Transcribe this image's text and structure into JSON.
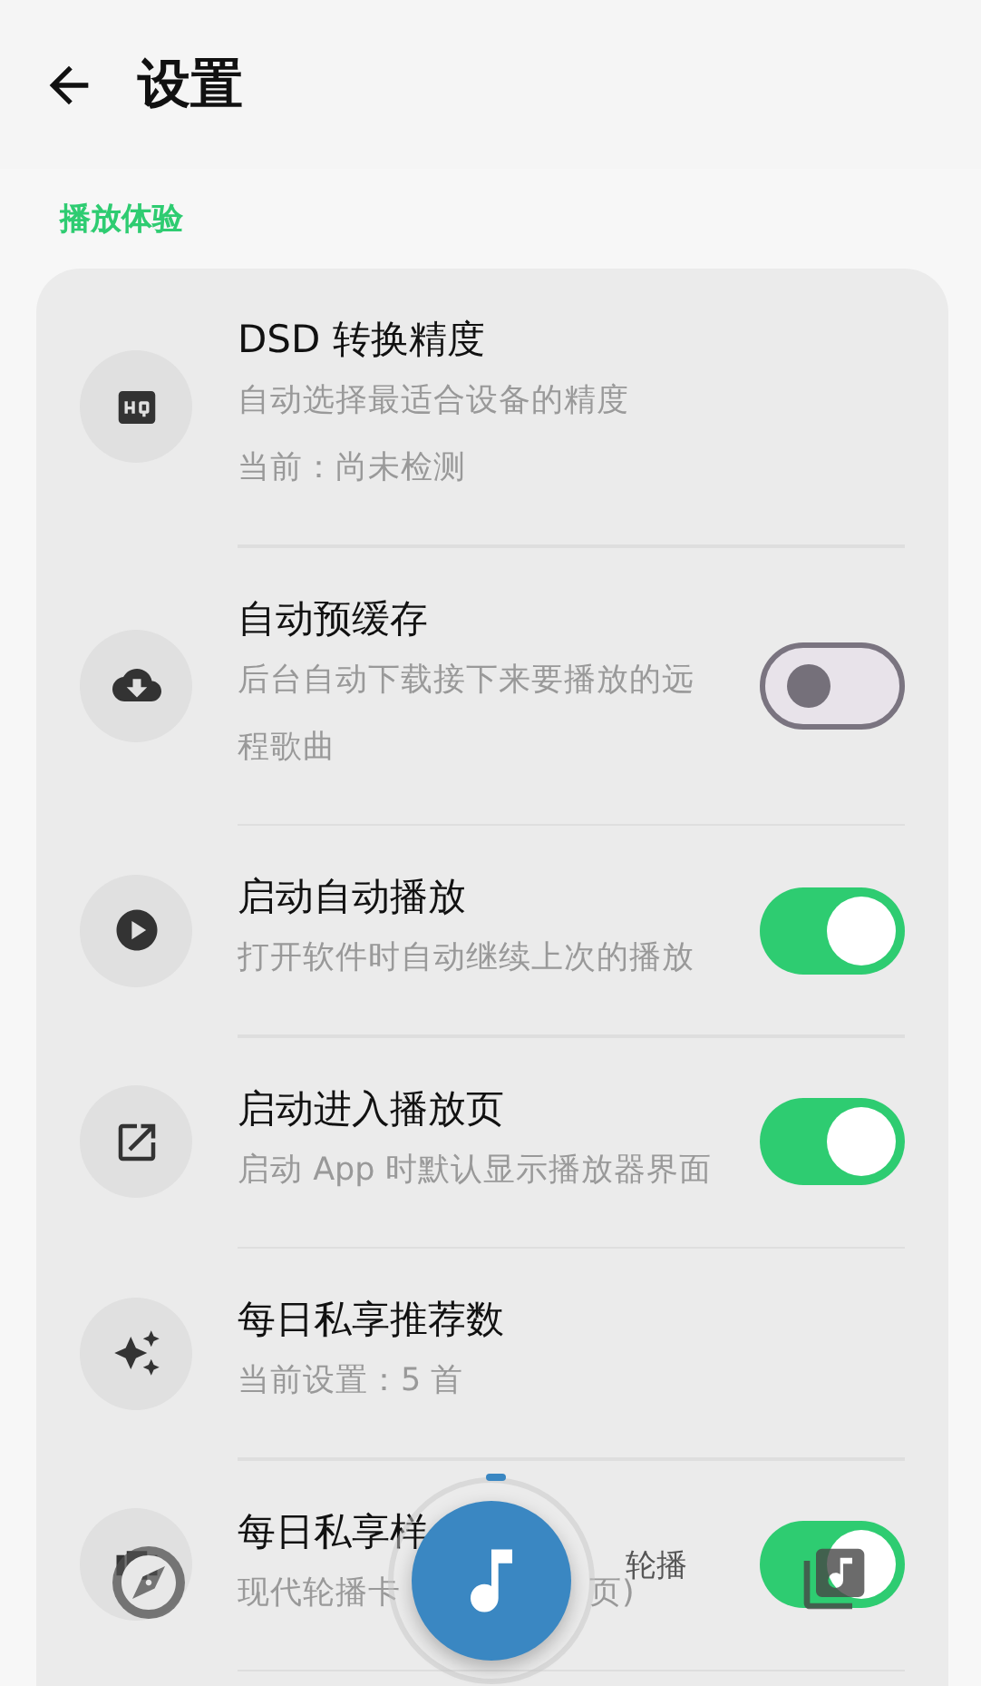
{
  "header": {
    "title": "设置"
  },
  "section": {
    "label": "播放体验"
  },
  "rows": [
    {
      "kind": "info",
      "title": "DSD 转换精度",
      "subtitle": [
        "自动选择最适合设备的精度",
        "当前：尚未检测"
      ]
    },
    {
      "kind": "toggle",
      "title": "自动预缓存",
      "subtitle": [
        "后台自动下载接下来要播放的远程歌曲"
      ],
      "on": false
    },
    {
      "kind": "toggle",
      "title": "启动自动播放",
      "subtitle": [
        "打开软件时自动继续上次的播放"
      ],
      "on": true
    },
    {
      "kind": "toggle",
      "title": "启动进入播放页",
      "subtitle": [
        "启动 App 时默认显示播放器界面"
      ],
      "on": true
    },
    {
      "kind": "info",
      "title": "每日私享推荐数",
      "subtitle": [
        "当前设置：5 首"
      ]
    },
    {
      "kind": "toggle",
      "title": "每日私享样",
      "subtitle_parts": [
        "现代轮播卡",
        "页)"
      ],
      "value": "轮播",
      "on": true
    }
  ]
}
